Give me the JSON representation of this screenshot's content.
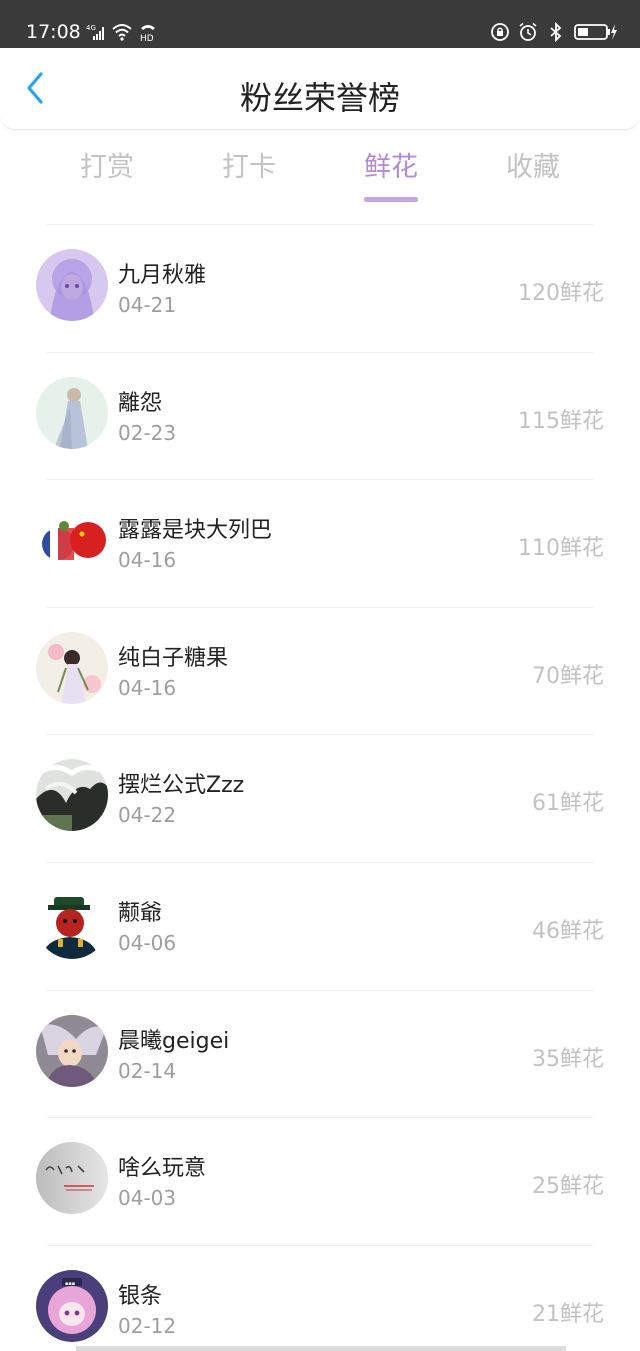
{
  "status_bar": {
    "time": "17:08",
    "network": "4G",
    "hd": "HD"
  },
  "header": {
    "title": "粉丝荣誉榜"
  },
  "tabs": [
    {
      "label": "打赏",
      "active": false
    },
    {
      "label": "打卡",
      "active": false
    },
    {
      "label": "鲜花",
      "active": true
    },
    {
      "label": "收藏",
      "active": false
    }
  ],
  "colors": {
    "accent": "#b18ad8",
    "underline": "#c7a6e6",
    "status_bar": "#3a3a3a"
  },
  "fans": [
    {
      "name": "九月秋雅",
      "date": "04-21",
      "score": "120鲜花",
      "avatar": "anime-girl-purple-hair"
    },
    {
      "name": "離怨",
      "date": "02-23",
      "score": "115鲜花",
      "avatar": "woman-white-dress"
    },
    {
      "name": "露露是块大列巴",
      "date": "04-16",
      "score": "110鲜花",
      "avatar": "countryballs"
    },
    {
      "name": "纯白子糖果",
      "date": "04-16",
      "score": "70鲜花",
      "avatar": "anime-girl-flowers"
    },
    {
      "name": "摆烂公式Zzz",
      "date": "04-22",
      "score": "61鲜花",
      "avatar": "snowy-tree-photo"
    },
    {
      "name": "颟爺",
      "date": "04-06",
      "score": "46鲜花",
      "avatar": "countryball-officer"
    },
    {
      "name": "晨曦geigei",
      "date": "02-14",
      "score": "35鲜花",
      "avatar": "anime-warrior"
    },
    {
      "name": "啥么玩意",
      "date": "04-03",
      "score": "25鲜花",
      "avatar": "handwriting-card"
    },
    {
      "name": "银条",
      "date": "02-12",
      "score": "21鲜花",
      "avatar": "chibi-pink-hair"
    }
  ]
}
